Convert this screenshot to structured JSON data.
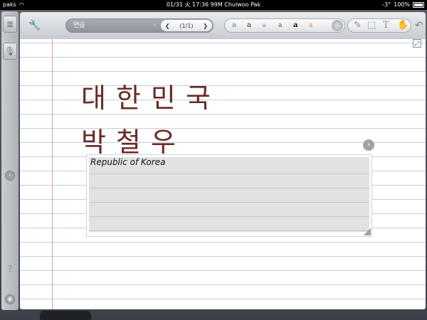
{
  "status_bar": {
    "carrier": "paks",
    "center_text": "01/31 火 17:36 99M Chulwoo Pak",
    "battery_percent": "100%",
    "signal_text": "-3°"
  },
  "toolbar": {
    "notebook_name": "연습",
    "page_indicator": "(1/1)",
    "font_samples": [
      {
        "glyph": "a",
        "color": "#6a6fd0"
      },
      {
        "glyph": "a",
        "color": "#333333"
      },
      {
        "glyph": "a",
        "color": "#6a6fd0"
      },
      {
        "glyph": "a",
        "color": "#555555"
      },
      {
        "glyph": "a",
        "color": "#111111"
      },
      {
        "glyph": "a",
        "color": "#e08a2a"
      }
    ],
    "text_tool_glyph": "T"
  },
  "page": {
    "handwriting_line1": "대한민국",
    "handwriting_line2": "박철우",
    "text_box": "Republic of Korea"
  },
  "left_rail": {
    "help_glyph": "?"
  },
  "colors": {
    "ink": "#6a2b27",
    "margin": "#e59a9a",
    "rule": "#c7cdd6"
  }
}
